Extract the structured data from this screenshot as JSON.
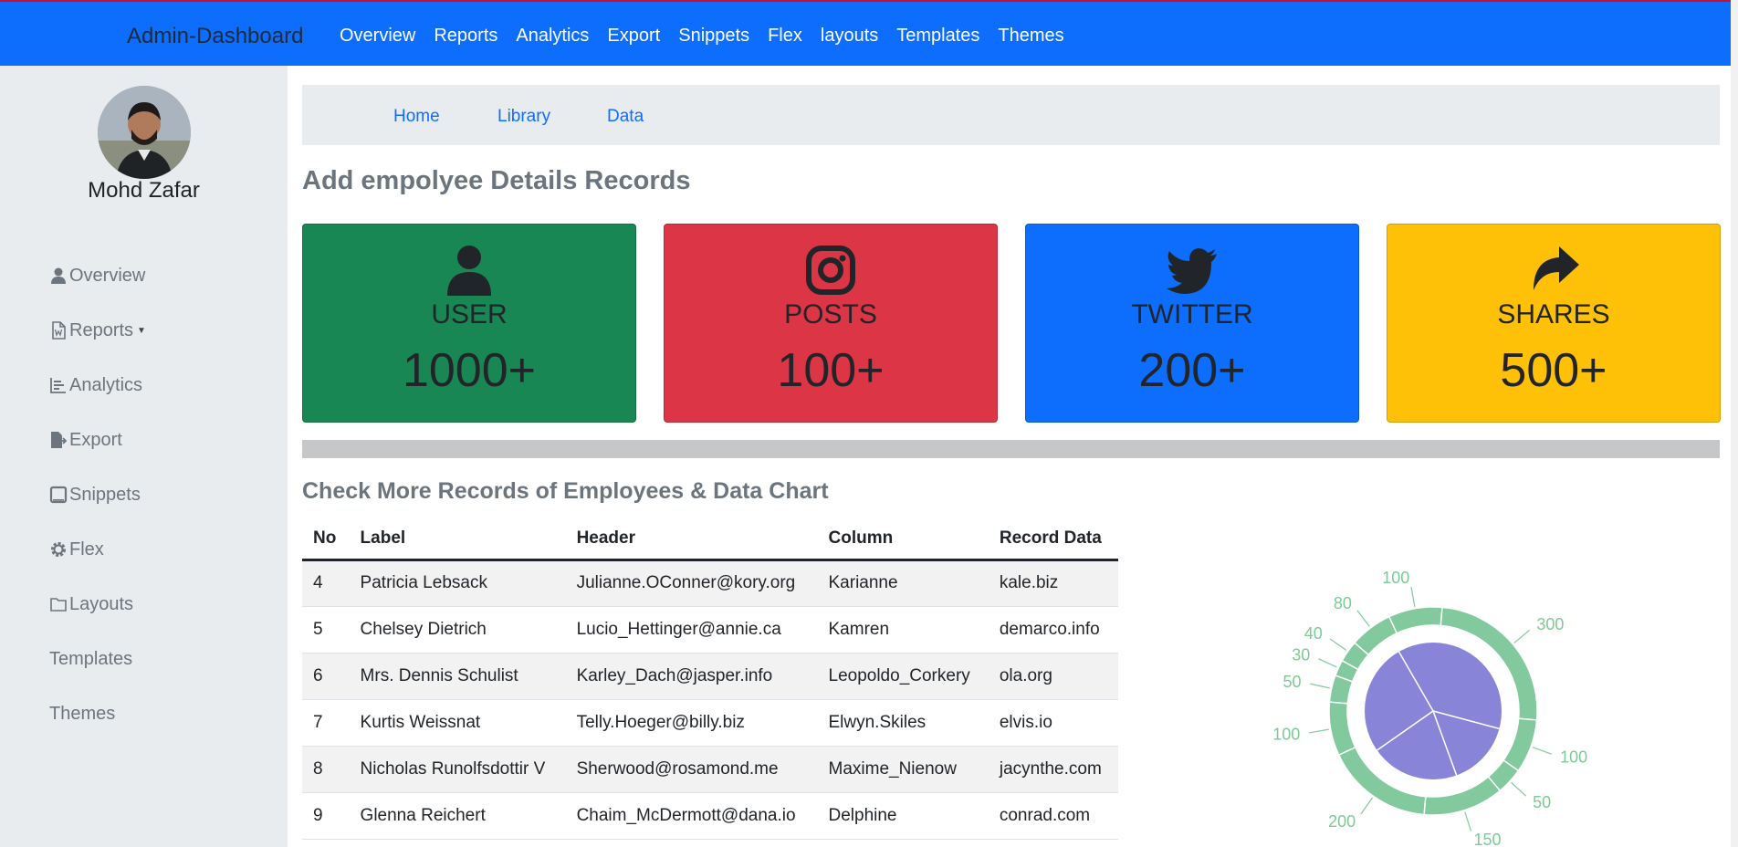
{
  "navbar": {
    "brand": "Admin-Dashboard",
    "links": [
      "Overview",
      "Reports",
      "Analytics",
      "Export",
      "Snippets",
      "Flex",
      "layouts",
      "Templates",
      "Themes"
    ]
  },
  "sidebar": {
    "user_name": "Mohd Zafar",
    "items": [
      {
        "label": "Overview",
        "icon": "user-icon"
      },
      {
        "label": "Reports",
        "icon": "file-word-icon"
      },
      {
        "label": "Analytics",
        "icon": "bar-chart-icon"
      },
      {
        "label": "Export",
        "icon": "file-export-icon"
      },
      {
        "label": "Snippets",
        "icon": "tablet-icon"
      },
      {
        "label": "Flex",
        "icon": "gear-icon"
      },
      {
        "label": "Layouts",
        "icon": "folder-icon"
      },
      {
        "label": "Templates",
        "icon": ""
      },
      {
        "label": "Themes",
        "icon": ""
      }
    ]
  },
  "breadcrumb": [
    "Home",
    "Library",
    "Data"
  ],
  "main": {
    "title": "Add empolyee Details Records",
    "section_title": "Check More Records of Employees & Data Chart"
  },
  "cards": [
    {
      "label": "USER",
      "value": "1000+",
      "icon": "user-icon",
      "color": "#198754"
    },
    {
      "label": "POSTS",
      "value": "100+",
      "icon": "instagram-icon",
      "color": "#dc3545"
    },
    {
      "label": "TWITTER",
      "value": "200+",
      "icon": "twitter-icon",
      "color": "#0d6efd"
    },
    {
      "label": "SHARES",
      "value": "500+",
      "icon": "share-icon",
      "color": "#ffc107"
    }
  ],
  "table": {
    "headers": [
      "No",
      "Label",
      "Header",
      "Column",
      "Record Data"
    ],
    "rows": [
      [
        "4",
        "Patricia Lebsack",
        "Julianne.OConner@kory.org",
        "Karianne",
        "kale.biz"
      ],
      [
        "5",
        "Chelsey Dietrich",
        "Lucio_Hettinger@annie.ca",
        "Kamren",
        "demarco.info"
      ],
      [
        "6",
        "Mrs. Dennis Schulist",
        "Karley_Dach@jasper.info",
        "Leopoldo_Corkery",
        "ola.org"
      ],
      [
        "7",
        "Kurtis Weissnat",
        "Telly.Hoeger@billy.biz",
        "Elwyn.Skiles",
        "elvis.io"
      ],
      [
        "8",
        "Nicholas Runolfsdottir V",
        "Sherwood@rosamond.me",
        "Maxime_Nienow",
        "jacynthe.com"
      ],
      [
        "9",
        "Glenna Reichert",
        "Chaim_McDermott@dana.io",
        "Delphine",
        "conrad.com"
      ]
    ]
  },
  "chart_data": {
    "type": "pie",
    "outer_ring": [
      {
        "label": "300",
        "value": 300
      },
      {
        "label": "100",
        "value": 100
      },
      {
        "label": "50",
        "value": 50
      },
      {
        "label": "150",
        "value": 150
      },
      {
        "label": "200",
        "value": 200
      },
      {
        "label": "100",
        "value": 100
      },
      {
        "label": "50",
        "value": 50
      },
      {
        "label": "30",
        "value": 30
      },
      {
        "label": "40",
        "value": 40
      },
      {
        "label": "80",
        "value": 80
      },
      {
        "label": "100",
        "value": 100
      }
    ],
    "inner_pie_slices": 4,
    "outer_color": "#82ca9d",
    "inner_color": "#8884d8"
  }
}
